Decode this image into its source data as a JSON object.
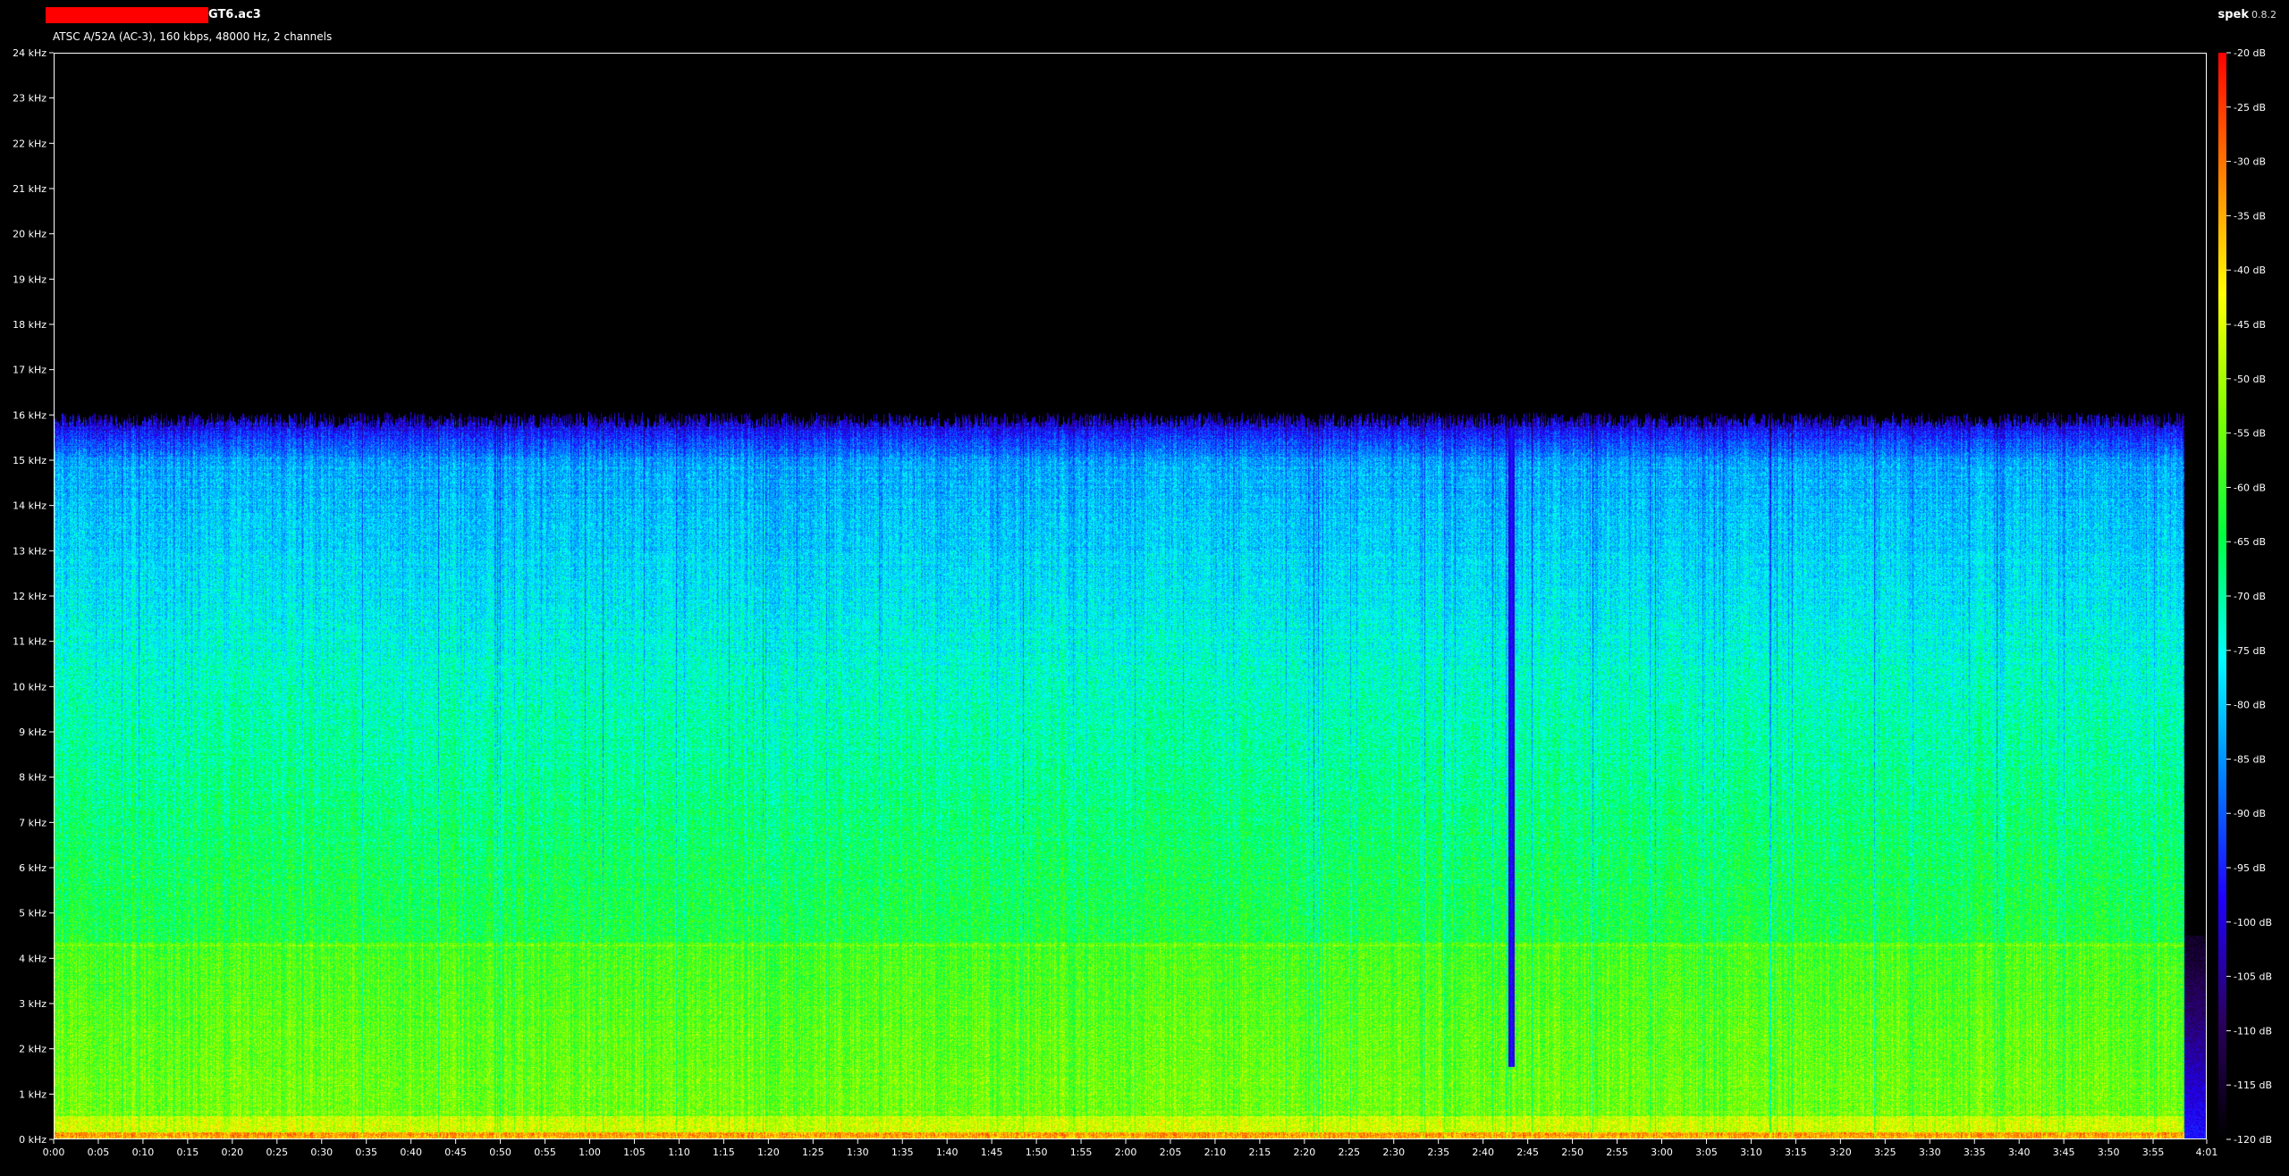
{
  "header": {
    "file_name": "GT6.ac3",
    "file_info": "ATSC A/52A (AC-3), 160 kbps, 48000 Hz, 2 channels",
    "app_name": "spek",
    "app_version": "0.8.2",
    "redaction_color": "#ff0000"
  },
  "chart_data": {
    "type": "heatmap",
    "title": "",
    "x_axis": {
      "range_seconds": [
        0,
        241
      ],
      "tick_labels": [
        "0:00",
        "0:05",
        "0:10",
        "0:15",
        "0:20",
        "0:25",
        "0:30",
        "0:35",
        "0:40",
        "0:45",
        "0:50",
        "0:55",
        "1:00",
        "1:05",
        "1:10",
        "1:15",
        "1:20",
        "1:25",
        "1:30",
        "1:35",
        "1:40",
        "1:45",
        "1:50",
        "1:55",
        "2:00",
        "2:05",
        "2:10",
        "2:15",
        "2:20",
        "2:25",
        "2:30",
        "2:35",
        "2:40",
        "2:45",
        "2:50",
        "2:55",
        "3:00",
        "3:05",
        "3:10",
        "3:15",
        "3:20",
        "3:25",
        "3:30",
        "3:35",
        "3:40",
        "3:45",
        "3:50",
        "3:55",
        "4:01"
      ],
      "tick_seconds": [
        0,
        5,
        10,
        15,
        20,
        25,
        30,
        35,
        40,
        45,
        50,
        55,
        60,
        65,
        70,
        75,
        80,
        85,
        90,
        95,
        100,
        105,
        110,
        115,
        120,
        125,
        130,
        135,
        140,
        145,
        150,
        155,
        160,
        165,
        170,
        175,
        180,
        185,
        190,
        195,
        200,
        205,
        210,
        215,
        220,
        225,
        230,
        235,
        241
      ]
    },
    "y_axis": {
      "range_khz": [
        0,
        24
      ],
      "tick_labels": [
        "0 kHz",
        "1 kHz",
        "2 kHz",
        "3 kHz",
        "4 kHz",
        "5 kHz",
        "6 kHz",
        "7 kHz",
        "8 kHz",
        "9 kHz",
        "10 kHz",
        "11 kHz",
        "12 kHz",
        "13 kHz",
        "14 kHz",
        "15 kHz",
        "16 kHz",
        "17 kHz",
        "18 kHz",
        "19 kHz",
        "20 kHz",
        "21 kHz",
        "22 kHz",
        "23 kHz",
        "24 kHz"
      ],
      "tick_khz": [
        0,
        1,
        2,
        3,
        4,
        5,
        6,
        7,
        8,
        9,
        10,
        11,
        12,
        13,
        14,
        15,
        16,
        17,
        18,
        19,
        20,
        21,
        22,
        23,
        24
      ]
    },
    "color_scale": {
      "range_db": [
        -120,
        -20
      ],
      "tick_labels": [
        "-20 dB",
        "-25 dB",
        "-30 dB",
        "-35 dB",
        "-40 dB",
        "-45 dB",
        "-50 dB",
        "-55 dB",
        "-60 dB",
        "-65 dB",
        "-70 dB",
        "-75 dB",
        "-80 dB",
        "-85 dB",
        "-90 dB",
        "-95 dB",
        "-100 dB",
        "-105 dB",
        "-110 dB",
        "-115 dB",
        "-120 dB"
      ],
      "tick_db": [
        -20,
        -25,
        -30,
        -35,
        -40,
        -45,
        -50,
        -55,
        -60,
        -65,
        -70,
        -75,
        -80,
        -85,
        -90,
        -95,
        -100,
        -105,
        -110,
        -115,
        -120
      ],
      "colormap": [
        "#000000",
        "#2a0060",
        "#2000ff",
        "#0080ff",
        "#00ffff",
        "#00ff40",
        "#80ff00",
        "#ffff00",
        "#ff8000",
        "#ff0000"
      ]
    },
    "features": {
      "lowpass_cutoff_khz": 15.9,
      "signal_end_seconds": 238.5,
      "dropout_seconds": 163.2,
      "band_khz": 4.3
    }
  }
}
